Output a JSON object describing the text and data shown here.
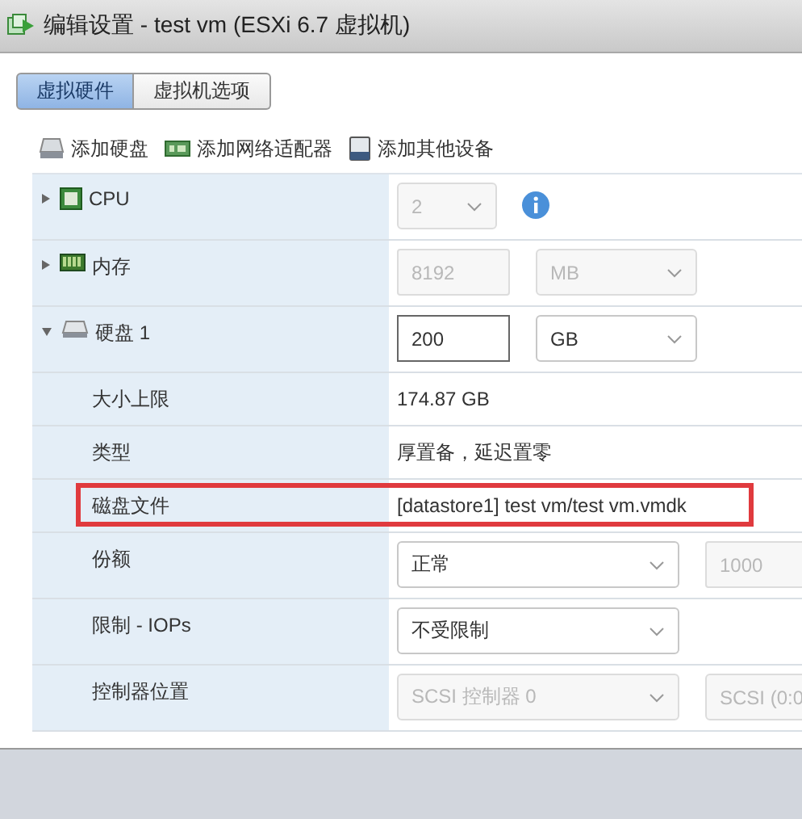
{
  "window": {
    "title": "编辑设置 - test vm (ESXi 6.7 虚拟机)"
  },
  "tabs": [
    {
      "label": "虚拟硬件",
      "selected": true
    },
    {
      "label": "虚拟机选项",
      "selected": false
    }
  ],
  "toolbar": [
    {
      "kind": "disk",
      "label": "添加硬盘"
    },
    {
      "kind": "network",
      "label": "添加网络适配器"
    },
    {
      "kind": "device",
      "label": "添加其他设备"
    }
  ],
  "rows": [
    {
      "kind": "cpu",
      "label": "CPU",
      "expanded": false,
      "controls": [
        {
          "kind": "select",
          "value": "2",
          "disabled": true
        },
        {
          "kind": "info"
        }
      ]
    },
    {
      "kind": "memory",
      "label": "内存",
      "expanded": false,
      "controls": [
        {
          "kind": "input",
          "value": "8192",
          "disabled": true
        },
        {
          "kind": "select",
          "value": "MB",
          "disabled": true
        }
      ]
    },
    {
      "kind": "disk",
      "label": "硬盘 1",
      "expanded": true,
      "controls": [
        {
          "kind": "input",
          "value": "200",
          "disabled": false
        },
        {
          "kind": "select",
          "value": "GB",
          "disabled": false
        }
      ]
    },
    {
      "kind": "property",
      "label": "大小上限",
      "highlighted": false,
      "controls": [
        {
          "kind": "text",
          "value": "174.87 GB"
        }
      ]
    },
    {
      "kind": "property",
      "label": "类型",
      "highlighted": false,
      "controls": [
        {
          "kind": "text",
          "value": "厚置备，延迟置零"
        }
      ]
    },
    {
      "kind": "property",
      "label": "磁盘文件",
      "highlighted": true,
      "controls": [
        {
          "kind": "text",
          "value": "[datastore1] test vm/test vm.vmdk"
        }
      ]
    },
    {
      "kind": "property",
      "label": "份额",
      "highlighted": false,
      "controls": [
        {
          "kind": "select",
          "value": "正常",
          "disabled": false
        },
        {
          "kind": "input",
          "value": "1000",
          "disabled": true
        }
      ]
    },
    {
      "kind": "property",
      "label": "限制 - IOPs",
      "highlighted": false,
      "controls": [
        {
          "kind": "select",
          "value": "不受限制",
          "disabled": false
        }
      ]
    },
    {
      "kind": "property",
      "label": "控制器位置",
      "highlighted": false,
      "controls": [
        {
          "kind": "select",
          "value": "SCSI 控制器 0",
          "disabled": true
        },
        {
          "kind": "select",
          "value": "SCSI (0:0",
          "disabled": true
        }
      ]
    }
  ]
}
